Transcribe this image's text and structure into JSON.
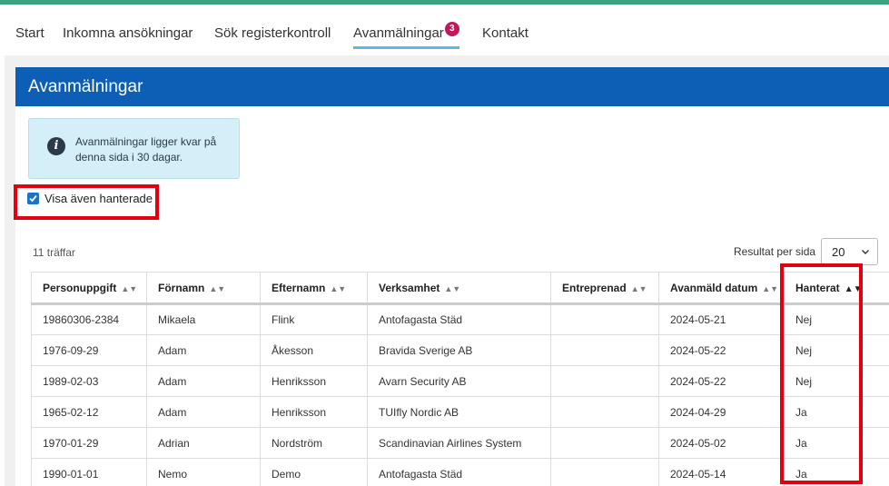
{
  "nav": {
    "items": [
      {
        "label": "Start"
      },
      {
        "label": "Inkomna ansökningar"
      },
      {
        "label": "Sök registerkontroll"
      },
      {
        "label": "Avanmälningar",
        "badge": "3"
      },
      {
        "label": "Kontakt"
      }
    ],
    "active_index": 3
  },
  "card": {
    "title": "Avanmälningar",
    "info_icon": "info-icon",
    "info_text": "Avanmälningar ligger kvar på denna sida i 30 dagar.",
    "checkbox_label": "Visa även hanterade",
    "checkbox_checked": true
  },
  "results": {
    "hits": "11 träffar",
    "per_page_label": "Resultat per sida",
    "per_page_value": "20"
  },
  "table": {
    "columns": [
      "Personuppgift",
      "Förnamn",
      "Efternamn",
      "Verksamhet",
      "Entreprenad",
      "Avanmäld datum",
      "Hanterat"
    ],
    "sorted_column": "Hanterat",
    "rows": [
      [
        "19860306-2384",
        "Mikaela",
        "Flink",
        "Antofagasta Städ",
        "",
        "2024-05-21",
        "Nej"
      ],
      [
        "1976-09-29",
        "Adam",
        "Åkesson",
        "Bravida Sverige AB",
        "",
        "2024-05-22",
        "Nej"
      ],
      [
        "1989-02-03",
        "Adam",
        "Henriksson",
        "Avarn Security AB",
        "",
        "2024-05-22",
        "Nej"
      ],
      [
        "1965-02-12",
        "Adam",
        "Henriksson",
        "TUIfly Nordic AB",
        "",
        "2024-04-29",
        "Ja"
      ],
      [
        "1970-01-29",
        "Adrian",
        "Nordström",
        "Scandinavian Airlines System",
        "",
        "2024-05-02",
        "Ja"
      ],
      [
        "1990-01-01",
        "Nemo",
        "Demo",
        "Antofagasta Städ",
        "",
        "2024-05-14",
        "Ja"
      ]
    ]
  },
  "colors": {
    "top_bar": "#3aa37e",
    "header_blue": "#0d5fb5",
    "badge": "#c2185b",
    "highlight_red": "#e3000f",
    "info_bg": "#d4eff8"
  }
}
